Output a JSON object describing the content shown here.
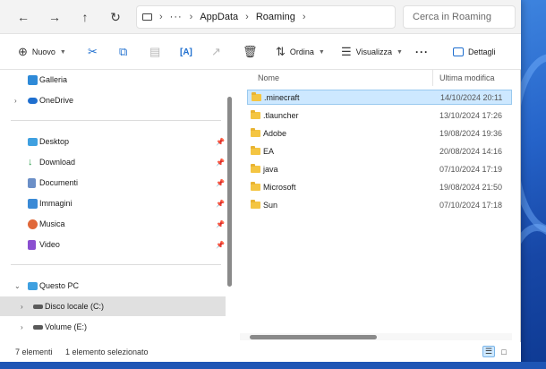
{
  "nav": {
    "back_icon": "arrow-left-icon",
    "forward_icon": "arrow-right-icon",
    "up_icon": "arrow-up-icon",
    "refresh_icon": "refresh-icon"
  },
  "address": {
    "crumbs": [
      "AppData",
      "Roaming"
    ],
    "overflow": "···"
  },
  "search": {
    "placeholder": "Cerca in Roaming"
  },
  "toolbar": {
    "new_label": "Nuovo",
    "sort_label": "Ordina",
    "view_label": "Visualizza",
    "more_label": "···",
    "details_label": "Dettagli"
  },
  "sidebar": {
    "items": [
      {
        "label": "Galleria"
      },
      {
        "label": "OneDrive"
      },
      {
        "label": "Desktop"
      },
      {
        "label": "Download"
      },
      {
        "label": "Documenti"
      },
      {
        "label": "Immagini"
      },
      {
        "label": "Musica"
      },
      {
        "label": "Video"
      },
      {
        "label": "Questo PC"
      },
      {
        "label": "Disco locale (C:)"
      },
      {
        "label": "Volume (E:)"
      }
    ]
  },
  "columns": {
    "name": "Nome",
    "modified": "Ultima modifica"
  },
  "files": [
    {
      "name": ".minecraft",
      "date": "14/10/2024 20:11"
    },
    {
      "name": ".tlauncher",
      "date": "13/10/2024 17:26"
    },
    {
      "name": "Adobe",
      "date": "19/08/2024 19:36"
    },
    {
      "name": "EA",
      "date": "20/08/2024 14:16"
    },
    {
      "name": "java",
      "date": "07/10/2024 17:19"
    },
    {
      "name": "Microsoft",
      "date": "19/08/2024 21:50"
    },
    {
      "name": "Sun",
      "date": "07/10/2024 17:18"
    }
  ],
  "status": {
    "count": "7 elementi",
    "selected": "1 elemento selezionato"
  },
  "colors": {
    "selection": "#cde8ff",
    "folder": "#f4c542",
    "accent": "#1f6fcf"
  }
}
